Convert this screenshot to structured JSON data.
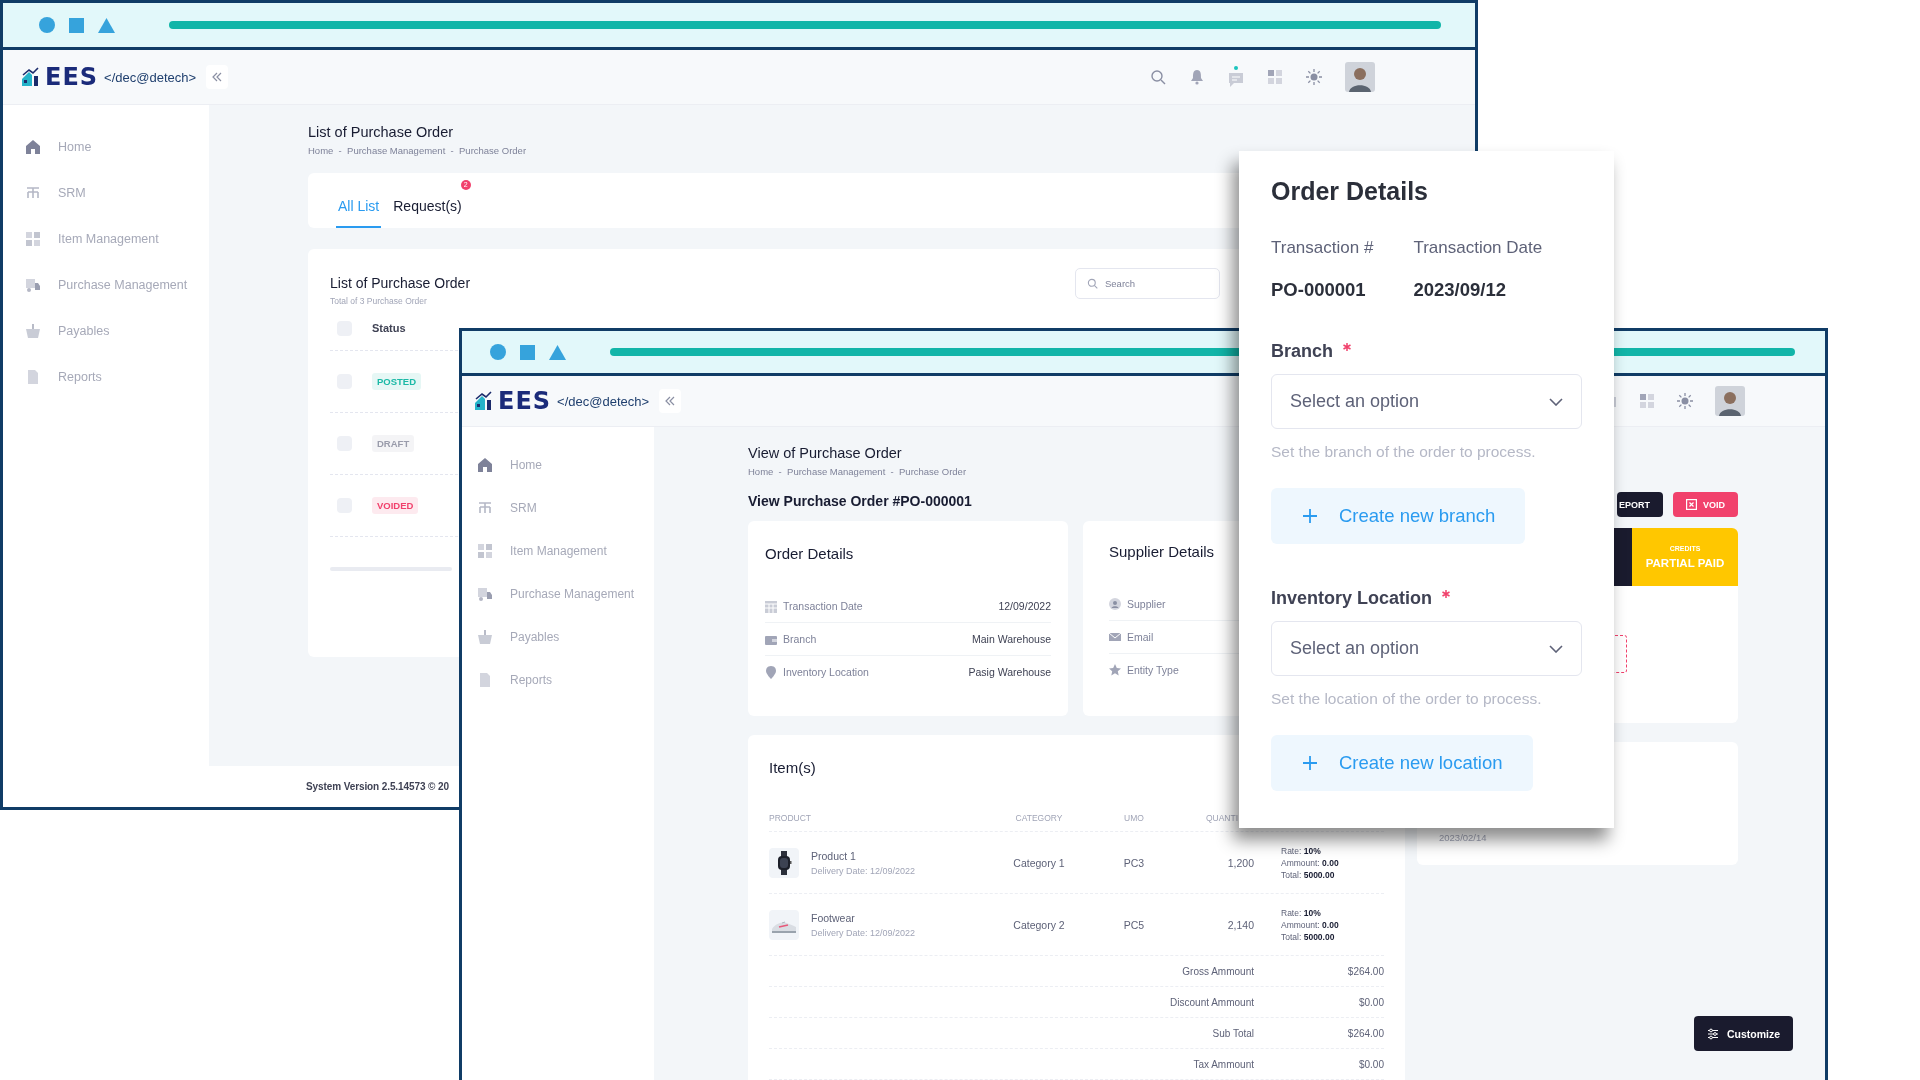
{
  "back_window": {
    "logo": {
      "mark": "EES",
      "tagline": "</dec@detech>"
    },
    "sidebar": {
      "items": [
        {
          "label": "Home"
        },
        {
          "label": "SRM"
        },
        {
          "label": "Item Management"
        },
        {
          "label": "Purchase Management"
        },
        {
          "label": "Payables"
        },
        {
          "label": "Reports"
        }
      ]
    },
    "page_title": "List of Purchase Order",
    "breadcrumb": "Home  -  Purchase Management  -  Purchase Order",
    "tabs": [
      {
        "label": "All List",
        "selected": true
      },
      {
        "label": "Request(s)",
        "selected": false,
        "badge": "2"
      }
    ],
    "list": {
      "title": "List of Purchase Order",
      "subtitle": "Total of 3 Purchase Order",
      "search": {
        "placeholder": "Search"
      },
      "header": {
        "label": "Status",
        "checked": false
      },
      "rows": [
        {
          "status": "POSTED",
          "color": "#1bb9a6",
          "checked": false
        },
        {
          "status": "DRAFT",
          "color": "#9a9cab",
          "checked": false
        },
        {
          "status": "VOIDED",
          "color": "#f1416c",
          "checked": false
        }
      ]
    },
    "footer": "System Version 2.5.14573 © 20"
  },
  "front_window": {
    "logo": {
      "mark": "EES",
      "tagline": "</dec@detech>"
    },
    "sidebar": {
      "items": [
        {
          "label": "Home"
        },
        {
          "label": "SRM"
        },
        {
          "label": "Item Management"
        },
        {
          "label": "Purchase Management"
        },
        {
          "label": "Payables"
        },
        {
          "label": "Reports"
        }
      ]
    },
    "page_title": "View of Purchase Order",
    "breadcrumb": "Home  -  Purchase Management  -  Purchase Order",
    "heading": "View Purchase Order #PO-000001",
    "order_card": {
      "title": "Order Details",
      "rows": [
        {
          "label": "Transaction Date",
          "value": "12/09/2022"
        },
        {
          "label": "Branch",
          "value": "Main Warehouse"
        },
        {
          "label": "Inventory Location",
          "value": "Pasig Warehouse"
        }
      ]
    },
    "supplier_card": {
      "title": "Supplier Details",
      "rows": [
        {
          "label": "Supplier"
        },
        {
          "label": "Email"
        },
        {
          "label": "Entity Type"
        }
      ]
    },
    "items": {
      "title": "Item(s)",
      "columns": [
        "PRODUCT",
        "CATEGORY",
        "UMO",
        "QUANTI"
      ],
      "rows": [
        {
          "name": "Product 1",
          "delivery": "Delivery Date: 12/09/2022",
          "category": "Category 1",
          "umo": "PC3",
          "quantity": "1,200",
          "rate": "Rate: **10%**",
          "amount": "Ammount: **0.00**",
          "total": "Total: **5000.00**"
        },
        {
          "name": "Footwear",
          "delivery": "Delivery Date: 12/09/2022",
          "category": "Category 2",
          "umo": "PC5",
          "quantity": "2,140",
          "rate": "Rate: **10%**",
          "amount": "Ammount: **0.00**",
          "total": "Total: **5000.00**"
        }
      ],
      "summary": [
        {
          "label": "Gross Ammount",
          "value": "$264.00"
        },
        {
          "label": "Discount Ammount",
          "value": "$0.00"
        },
        {
          "label": "Sub Total",
          "value": "$264.00"
        },
        {
          "label": "Tax Ammount",
          "value": "$0.00"
        }
      ]
    },
    "actions": [
      {
        "label": "EPORT",
        "kind": "report"
      },
      {
        "label": "VOID",
        "kind": "void"
      }
    ],
    "credits": {
      "caption": "CREDITS",
      "status": "PARTIAL PAID"
    },
    "date": "2023/02/14",
    "customize": "Customize"
  },
  "order_panel": {
    "title": "Order Details",
    "fields": [
      {
        "label": "Transaction #",
        "value": "PO-000001"
      },
      {
        "label": "Transaction Date",
        "value": "2023/09/12"
      }
    ],
    "selects": [
      {
        "label": "Branch",
        "required": true,
        "placeholder": "Select an option",
        "help": "Set the branch of the order to process.",
        "action": "Create new branch"
      },
      {
        "label": "Inventory Location",
        "required": true,
        "placeholder": "Select an option",
        "help": "Set the location of the order to process.",
        "action": "Create new location"
      }
    ]
  }
}
